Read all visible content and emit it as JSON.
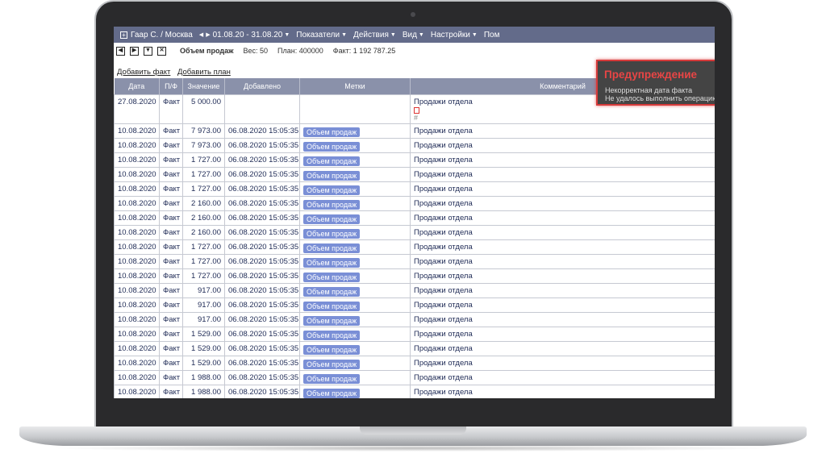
{
  "topbar": {
    "location": "Гаар С. / Москва",
    "date_range": "01.08.20 - 31.08.20",
    "menu": [
      "Показатели",
      "Действия",
      "Вид",
      "Настройки",
      "Пом"
    ]
  },
  "toolbar": {
    "title": "Объем продаж",
    "weight": "Вес: 50",
    "plan": "План: 400000",
    "fact": "Факт: 1 192 787.25"
  },
  "links": {
    "add_fact": "Добавить факт",
    "add_plan": "Добавить план"
  },
  "table": {
    "columns": [
      "Дата",
      "П/Ф",
      "Значение",
      "Добавлено",
      "Метки",
      "Комментарий"
    ],
    "rows": [
      {
        "date": "27.08.2020",
        "pf": "Факт",
        "value": "5 000.00",
        "added": "",
        "tag": "",
        "comment": "Продажи отдела"
      },
      {
        "date": "10.08.2020",
        "pf": "Факт",
        "value": "7 973.00",
        "added": "06.08.2020 15:05:35",
        "tag": "Объем продаж",
        "comment": "Продажи отдела"
      },
      {
        "date": "10.08.2020",
        "pf": "Факт",
        "value": "7 973.00",
        "added": "06.08.2020 15:05:35",
        "tag": "Объем продаж",
        "comment": "Продажи отдела"
      },
      {
        "date": "10.08.2020",
        "pf": "Факт",
        "value": "1 727.00",
        "added": "06.08.2020 15:05:35",
        "tag": "Объем продаж",
        "comment": "Продажи отдела"
      },
      {
        "date": "10.08.2020",
        "pf": "Факт",
        "value": "1 727.00",
        "added": "06.08.2020 15:05:35",
        "tag": "Объем продаж",
        "comment": "Продажи отдела"
      },
      {
        "date": "10.08.2020",
        "pf": "Факт",
        "value": "1 727.00",
        "added": "06.08.2020 15:05:35",
        "tag": "Объем продаж",
        "comment": "Продажи отдела"
      },
      {
        "date": "10.08.2020",
        "pf": "Факт",
        "value": "2 160.00",
        "added": "06.08.2020 15:05:35",
        "tag": "Объем продаж",
        "comment": "Продажи отдела"
      },
      {
        "date": "10.08.2020",
        "pf": "Факт",
        "value": "2 160.00",
        "added": "06.08.2020 15:05:35",
        "tag": "Объем продаж",
        "comment": "Продажи отдела"
      },
      {
        "date": "10.08.2020",
        "pf": "Факт",
        "value": "2 160.00",
        "added": "06.08.2020 15:05:35",
        "tag": "Объем продаж",
        "comment": "Продажи отдела"
      },
      {
        "date": "10.08.2020",
        "pf": "Факт",
        "value": "1 727.00",
        "added": "06.08.2020 15:05:35",
        "tag": "Объем продаж",
        "comment": "Продажи отдела"
      },
      {
        "date": "10.08.2020",
        "pf": "Факт",
        "value": "1 727.00",
        "added": "06.08.2020 15:05:35",
        "tag": "Объем продаж",
        "comment": "Продажи отдела"
      },
      {
        "date": "10.08.2020",
        "pf": "Факт",
        "value": "1 727.00",
        "added": "06.08.2020 15:05:35",
        "tag": "Объем продаж",
        "comment": "Продажи отдела"
      },
      {
        "date": "10.08.2020",
        "pf": "Факт",
        "value": "917.00",
        "added": "06.08.2020 15:05:35",
        "tag": "Объем продаж",
        "comment": "Продажи отдела"
      },
      {
        "date": "10.08.2020",
        "pf": "Факт",
        "value": "917.00",
        "added": "06.08.2020 15:05:35",
        "tag": "Объем продаж",
        "comment": "Продажи отдела"
      },
      {
        "date": "10.08.2020",
        "pf": "Факт",
        "value": "917.00",
        "added": "06.08.2020 15:05:35",
        "tag": "Объем продаж",
        "comment": "Продажи отдела"
      },
      {
        "date": "10.08.2020",
        "pf": "Факт",
        "value": "1 529.00",
        "added": "06.08.2020 15:05:35",
        "tag": "Объем продаж",
        "comment": "Продажи отдела"
      },
      {
        "date": "10.08.2020",
        "pf": "Факт",
        "value": "1 529.00",
        "added": "06.08.2020 15:05:35",
        "tag": "Объем продаж",
        "comment": "Продажи отдела"
      },
      {
        "date": "10.08.2020",
        "pf": "Факт",
        "value": "1 529.00",
        "added": "06.08.2020 15:05:35",
        "tag": "Объем продаж",
        "comment": "Продажи отдела"
      },
      {
        "date": "10.08.2020",
        "pf": "Факт",
        "value": "1 988.00",
        "added": "06.08.2020 15:05:35",
        "tag": "Объем продаж",
        "comment": "Продажи отдела"
      },
      {
        "date": "10.08.2020",
        "pf": "Факт",
        "value": "1 988.00",
        "added": "06.08.2020 15:05:35",
        "tag": "Объем продаж",
        "comment": "Продажи отдела"
      }
    ]
  },
  "warning": {
    "title": "Предупреждение",
    "line1": "Некорректная дата факта",
    "line2": "Не удалось выполнить операцию",
    "close": "✖"
  }
}
